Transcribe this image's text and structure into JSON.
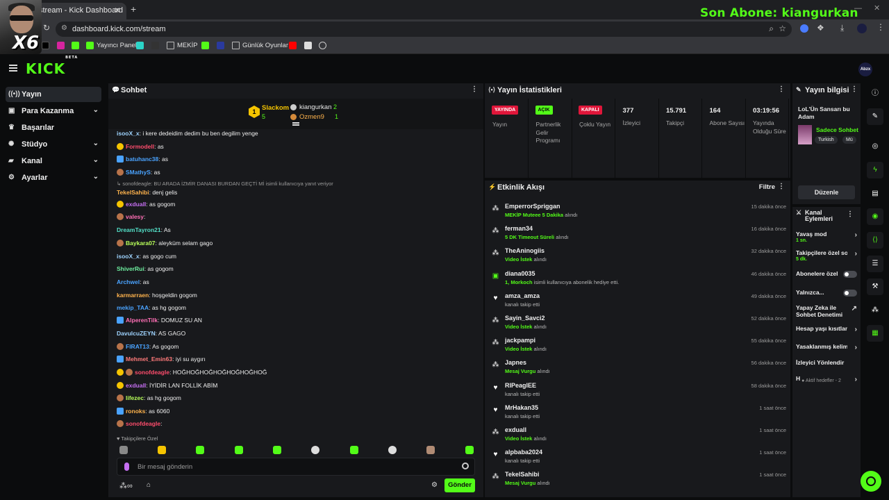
{
  "browser": {
    "tab_title": "stream - Kick Dashboard",
    "url": "dashboard.kick.com/stream",
    "overlay_text": "Son Abone: kiangurkan",
    "cam_text": "X6",
    "bookmarks": [
      "Yayıncı Paneli",
      "MEKİP",
      "Günlük Oyunlar"
    ]
  },
  "colors": {
    "accent": "#53fc18",
    "live": "#e0163a",
    "bg": "#0b0c0d",
    "panel": "#18191c"
  },
  "header": {
    "logo": "KICK",
    "logo_sup": "BETA",
    "avatar": "Abzx"
  },
  "sidebar": {
    "items": [
      {
        "label": "Yayın",
        "icon": "broadcast-icon",
        "expand": false
      },
      {
        "label": "Para Kazanma",
        "icon": "money-icon",
        "expand": true
      },
      {
        "label": "Başarılar",
        "icon": "trophy-icon",
        "expand": false
      },
      {
        "label": "Stüdyo",
        "icon": "studio-icon",
        "expand": true
      },
      {
        "label": "Kanal",
        "icon": "channel-icon",
        "expand": true
      },
      {
        "label": "Ayarlar",
        "icon": "gear-icon",
        "expand": true
      }
    ]
  },
  "chat": {
    "title": "Sohbet",
    "pinned": {
      "top_user": "Slackom",
      "top_count": "5",
      "top_rank": "1",
      "u2": "kiangurkan",
      "u2_count": "2",
      "u3": "Ozmen9",
      "u3_count": "1"
    },
    "reply_to": "sonofdeagle: BU ARADA İZMİR DANASI BURDAN GEÇTİ Mİ",
    "reply_note": "isimli kullanıcıya yanıt veriyor",
    "messages": [
      {
        "user": "isooX_x",
        "text": "i kere dedeidim dedim bu ben degilim yenge",
        "color": "#9fd4ff"
      },
      {
        "user": "Formodell",
        "text": "as",
        "color": "#ff4d6d"
      },
      {
        "user": "batuhanc38",
        "text": "as",
        "color": "#4aa3ff"
      },
      {
        "user": "SMathyS",
        "text": "as",
        "color": "#4aa3ff"
      },
      {
        "user": "TekelSahibi",
        "text": "denj gelis",
        "color": "#ffb34d"
      },
      {
        "user": "exdualI",
        "text": "as gogom",
        "color": "#c46ef0"
      },
      {
        "user": "valesy",
        "text": "",
        "color": "#ff6fb5"
      },
      {
        "user": "DreamTayron21",
        "text": "As",
        "color": "#53e0c8"
      },
      {
        "user": "Baykara07",
        "text": "aleyküm selam gago",
        "color": "#b8ff5a"
      },
      {
        "user": "isooX_x",
        "text": "as gogo cum",
        "color": "#9fd4ff"
      },
      {
        "user": "ShiverRui",
        "text": "as gogom",
        "color": "#6ef0a0"
      },
      {
        "user": "Archwel",
        "text": "as",
        "color": "#4aa3ff"
      },
      {
        "user": "karmarraen",
        "text": "hoşgeldin gogom",
        "color": "#ffb34d"
      },
      {
        "user": "mekip_TAA",
        "text": "as hg gogom",
        "color": "#4aa3ff"
      },
      {
        "user": "AlperenTilk",
        "text": "DOMUZ SU AN",
        "color": "#ff6fb5"
      },
      {
        "user": "DavulcuZEYN",
        "text": "AS GAGO",
        "color": "#9fd4ff"
      },
      {
        "user": "FIRAT13",
        "text": "As gogom",
        "color": "#4aa3ff"
      },
      {
        "user": "Mehmet_Emin63",
        "text": "iyi su aygırı",
        "color": "#ff7a7a"
      },
      {
        "user": "sonofdeagle",
        "text": "HOĞHOĞHOĞHOĞHOĞHOĞHOĞ",
        "color": "#ff4d6d"
      },
      {
        "user": "exdualI",
        "text": "İYİDİR LAN FOLLİK ABİM",
        "color": "#c46ef0"
      },
      {
        "user": "lifezec",
        "text": "as hg gogom",
        "color": "#b8ff5a"
      },
      {
        "user": "ronoks",
        "text": "as 6060",
        "color": "#ffb34d"
      },
      {
        "user": "sonofdeagle",
        "text": "",
        "color": "#ff4d6d"
      }
    ],
    "followers_only": "Takipçilere Özel",
    "placeholder": "Bir mesaj gönderin",
    "send": "Gönder"
  },
  "stats": {
    "title": "Yayın İstatistikleri",
    "items": [
      {
        "pill": "YAYINDA",
        "label": "Yayın",
        "kind": "live"
      },
      {
        "pill": "AÇIK",
        "label": "Partnerlik Gelir Programı",
        "kind": "on"
      },
      {
        "pill": "KAPALI",
        "label": "Çoklu Yayın",
        "kind": "off"
      },
      {
        "value": "377",
        "label": "İzleyici"
      },
      {
        "value": "15.791",
        "label": "Takipçi"
      },
      {
        "value": "164",
        "label": "Abone Sayısı"
      },
      {
        "value": "03:19:56",
        "label": "Yayında Olduğu Süre"
      }
    ]
  },
  "events": {
    "title": "Etkinlik Akışı",
    "filter": "Filtre",
    "items": [
      {
        "user": "EmperrorSpriggan",
        "hl": "MEKİP Muteee 5 Dakika",
        "rest": " alındı",
        "time": "15 dakika önce",
        "icon": "reward-icon"
      },
      {
        "user": "ferman34",
        "hl": "5 DK Timeout Süreli",
        "rest": " alındı",
        "time": "16 dakika önce",
        "icon": "reward-icon"
      },
      {
        "user": "TheAninogiis",
        "hl": "Video İstek",
        "rest": " alındı",
        "time": "32 dakika önce",
        "icon": "reward-icon"
      },
      {
        "user": "diana0035",
        "hl": "1, Morkoch",
        "rest": " isimli kullanıcıya abonelik hediye etti.",
        "time": "46 dakika önce",
        "icon": "gift-icon"
      },
      {
        "user": "amza_amza",
        "hl": "",
        "rest": "kanalı takip etti",
        "time": "49 dakika önce",
        "icon": "heart-icon"
      },
      {
        "user": "Sayin_Savci2",
        "hl": "Video İstek",
        "rest": " alındı",
        "time": "52 dakika önce",
        "icon": "reward-icon"
      },
      {
        "user": "jackpampi",
        "hl": "Video İstek",
        "rest": " alındı",
        "time": "55 dakika önce",
        "icon": "reward-icon"
      },
      {
        "user": "Japnes",
        "hl": "Mesaj Vurgu",
        "rest": " alındı",
        "time": "56 dakika önce",
        "icon": "reward-icon"
      },
      {
        "user": "RIPeaglEE",
        "hl": "",
        "rest": "kanalı takip etti",
        "time": "58 dakika önce",
        "icon": "heart-icon"
      },
      {
        "user": "MrHakan35",
        "hl": "",
        "rest": "kanalı takip etti",
        "time": "1 saat önce",
        "icon": "heart-icon"
      },
      {
        "user": "exduall",
        "hl": "Video İstek",
        "rest": " alındı",
        "time": "1 saat önce",
        "icon": "reward-icon"
      },
      {
        "user": "alpbaba2024",
        "hl": "",
        "rest": "kanalı takip etti",
        "time": "1 saat önce",
        "icon": "heart-icon"
      },
      {
        "user": "TekelSahibi",
        "hl": "Mesaj Vurgu",
        "rest": " alındı",
        "time": "1 saat önce",
        "icon": "reward-icon"
      }
    ]
  },
  "stream_info": {
    "title": "Yayın bilgisi",
    "stream_title": "LoL'Ün Sansarı bu Adam",
    "category": "Sadece Sohbet",
    "tags": [
      "Turkish",
      "Mü"
    ],
    "edit": "Düzenle"
  },
  "actions": {
    "title": "Kanal Eylemleri",
    "items": [
      {
        "label": "Yavaş mod",
        "sub": "1 sn.",
        "type": "arrow"
      },
      {
        "label": "Takipçilere özel sohbet",
        "sub": "5 dk.",
        "type": "arrow"
      },
      {
        "label": "Abonelere özel",
        "sub": "",
        "type": "toggle"
      },
      {
        "label": "Yalnızca...",
        "sub": "",
        "type": "toggle"
      },
      {
        "label": "Yapay Zeka ile Sohbet Denetimi",
        "sub": "",
        "type": "ext"
      },
      {
        "label": "Hesap yaşı kısıtlaması",
        "sub": "",
        "type": "arrow"
      },
      {
        "label": "Yasaklanmış kelimeler",
        "sub": "",
        "type": "arrow"
      },
      {
        "label": "İzleyici Yönlendir",
        "sub": "",
        "type": "none"
      },
      {
        "label": "H",
        "sub": "Aktif hedefler - 2",
        "type": "arrow"
      }
    ]
  }
}
